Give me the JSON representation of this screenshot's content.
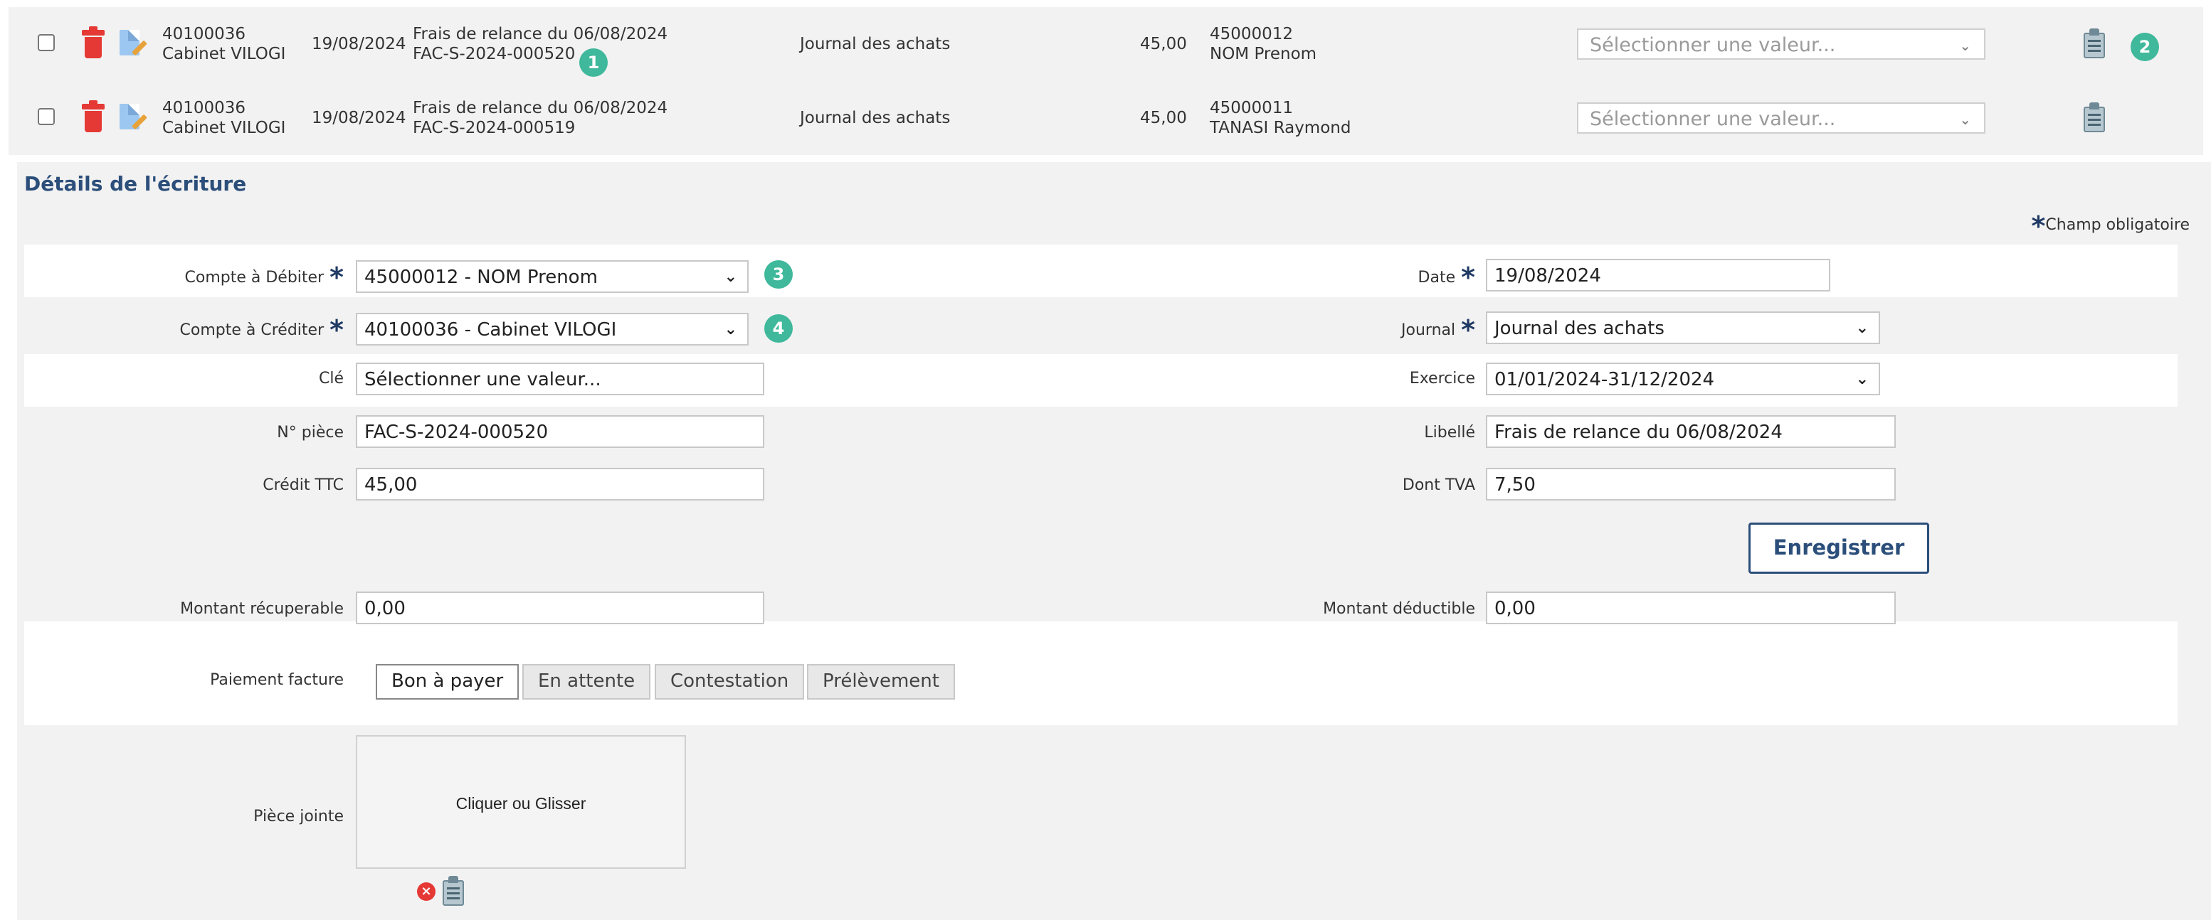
{
  "rows": [
    {
      "account_no": "40100036",
      "account_name": "Cabinet VILOGI",
      "date": "19/08/2024",
      "label_line1": "Frais de relance du 06/08/2024",
      "label_line2": "FAC-S-2024-000520",
      "journal": "Journal des achats",
      "amount": "45,00",
      "contra_no": "45000012",
      "contra_name": "NOM Prenom",
      "select_placeholder": "Sélectionner une valeur..."
    },
    {
      "account_no": "40100036",
      "account_name": "Cabinet VILOGI",
      "date": "19/08/2024",
      "label_line1": "Frais de relance du 06/08/2024",
      "label_line2": "FAC-S-2024-000519",
      "journal": "Journal des achats",
      "amount": "45,00",
      "contra_no": "45000011",
      "contra_name": "TANASI Raymond",
      "select_placeholder": "Sélectionner une valeur..."
    }
  ],
  "badges": [
    "1",
    "2",
    "3",
    "4"
  ],
  "details": {
    "title": "Détails de l'écriture",
    "required_note": "Champ obligatoire",
    "required_star": "*",
    "compte_debit_label": "Compte à Débiter",
    "compte_debit_value": "45000012 - NOM Prenom",
    "compte_credit_label": "Compte à Créditer",
    "compte_credit_value": "40100036 - Cabinet VILOGI",
    "cle_label": "Clé",
    "cle_value": "Sélectionner une valeur...",
    "piece_label": "N° pièce",
    "piece_value": "FAC-S-2024-000520",
    "credit_ttc_label": "Crédit TTC",
    "credit_ttc_value": "45,00",
    "date_label": "Date",
    "date_value": "19/08/2024",
    "journal_label": "Journal",
    "journal_value": "Journal des achats",
    "exercice_label": "Exercice",
    "exercice_value": "01/01/2024-31/12/2024",
    "libelle_label": "Libellé",
    "libelle_value": "Frais de relance du 06/08/2024",
    "tva_label": "Dont TVA",
    "tva_value": "7,50",
    "save_label": "Enregistrer",
    "recup_label": "Montant récuperable",
    "recup_value": "0,00",
    "deduct_label": "Montant déductible",
    "deduct_value": "0,00",
    "paiement_label": "Paiement facture",
    "paiement_options": [
      "Bon à payer",
      "En attente",
      "Contestation",
      "Prélèvement"
    ],
    "piece_jointe_label": "Pièce jointe",
    "dropzone_text": "Cliquer ou Glisser"
  },
  "colors": {
    "accent": "#2b4e7a",
    "badge": "#3fb89b",
    "delete": "#e53935",
    "row_bg": "#f2f2f2"
  },
  "icons": {
    "row_delete": "trash-icon",
    "row_edit": "edit-document-icon",
    "row_notes": "notepad-icon",
    "remove_attachment": "remove-circle-icon"
  }
}
